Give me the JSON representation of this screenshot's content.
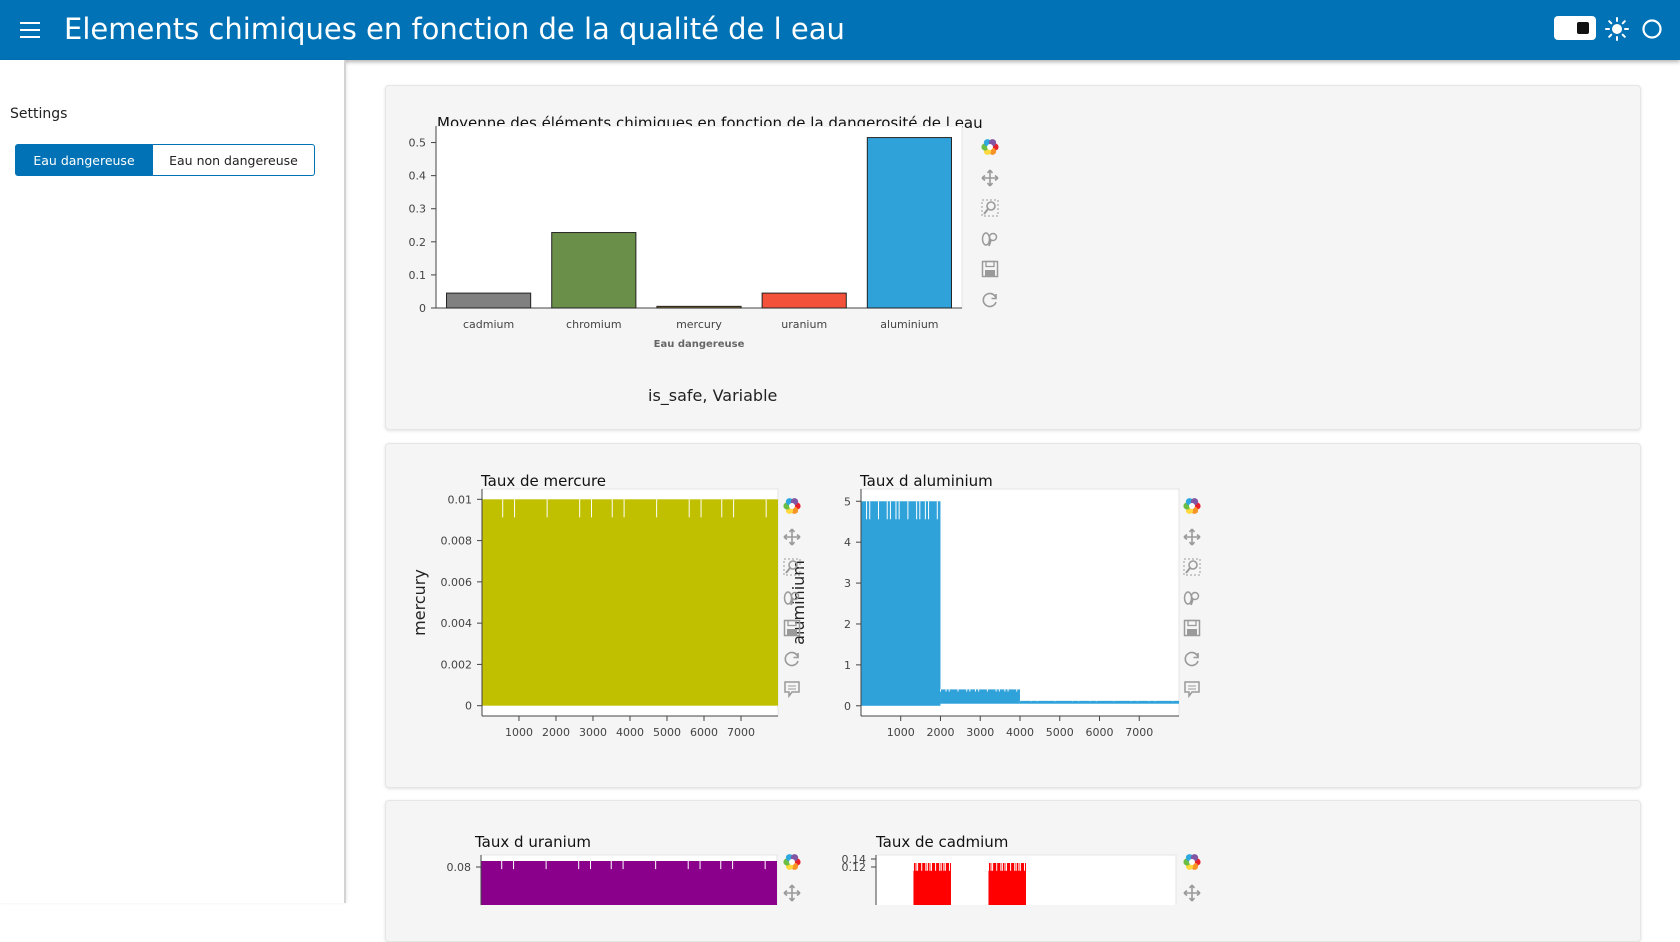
{
  "header": {
    "title": "Elements chimiques en fonction de la qualité de l eau",
    "background": "#0072b5"
  },
  "sidebar": {
    "title": "Settings",
    "buttons": [
      {
        "label": "Eau dangereuse",
        "active": true
      },
      {
        "label": "Eau non dangereuse",
        "active": false
      }
    ]
  },
  "main": {
    "bar_card": {
      "caption": "is_safe, Variable"
    }
  },
  "toolbar": {
    "icons": [
      "bokeh-logo-icon",
      "pan-icon",
      "box-zoom-icon",
      "wheel-zoom-icon",
      "save-icon",
      "reset-icon",
      "hover-icon"
    ]
  },
  "chart_data": [
    {
      "type": "bar",
      "title": "Moyenne des éléments chimiques en fonction de la dangerosité de l eau",
      "xlabel": "Eau dangereuse",
      "ylabel": "",
      "categories": [
        "cadmium",
        "chromium",
        "mercury",
        "uranium",
        "aluminium"
      ],
      "values": [
        0.045,
        0.228,
        0.005,
        0.045,
        0.515
      ],
      "colors": [
        "#808080",
        "#6a8f48",
        "#8b7433",
        "#f4513b",
        "#30a2da"
      ],
      "ylim": [
        0,
        0.55
      ],
      "yticks": [
        0,
        0.1,
        0.2,
        0.3,
        0.4,
        0.5
      ],
      "ytick_labels": [
        "0",
        "0.1",
        "0.2",
        "0.3",
        "0.4",
        "0.5"
      ]
    },
    {
      "type": "line",
      "title": "Taux de mercure",
      "xlabel": "",
      "ylabel": "mercury",
      "color": "#c0bf00",
      "xlim": [
        1,
        8000
      ],
      "ylim": [
        -0.0005,
        0.0105
      ],
      "xticks": [
        1000,
        2000,
        3000,
        4000,
        5000,
        6000,
        7000
      ],
      "xtick_labels": [
        "1000",
        "2000",
        "3000",
        "4000",
        "5000",
        "6000",
        "7000"
      ],
      "yticks": [
        0,
        0.002,
        0.004,
        0.006,
        0.008,
        0.01
      ],
      "ytick_labels": [
        "0",
        "0.002",
        "0.004",
        "0.006",
        "0.008",
        "0.01"
      ],
      "segments": [
        {
          "x0": 1,
          "x1": 8000,
          "lo": 0,
          "hi": 0.01
        }
      ]
    },
    {
      "type": "line",
      "title": "Taux d aluminium",
      "xlabel": "",
      "ylabel": "aluminium",
      "color": "#30a2da",
      "xlim": [
        1,
        8000
      ],
      "ylim": [
        -0.25,
        5.3
      ],
      "xticks": [
        1000,
        2000,
        3000,
        4000,
        5000,
        6000,
        7000
      ],
      "xtick_labels": [
        "1000",
        "2000",
        "3000",
        "4000",
        "5000",
        "6000",
        "7000"
      ],
      "yticks": [
        0,
        1,
        2,
        3,
        4,
        5
      ],
      "ytick_labels": [
        "0",
        "1",
        "2",
        "3",
        "4",
        "5"
      ],
      "segments": [
        {
          "x0": 1,
          "x1": 2000,
          "lo": 0,
          "hi": 5.0
        },
        {
          "x0": 2000,
          "x1": 4000,
          "lo": 0.05,
          "hi": 0.4
        },
        {
          "x0": 4000,
          "x1": 8000,
          "lo": 0.05,
          "hi": 0.12
        }
      ]
    },
    {
      "type": "line",
      "title": "Taux d uranium",
      "xlabel": "",
      "ylabel": "",
      "color": "#8b008b",
      "xlim": [
        1,
        8000
      ],
      "ylim": [
        0,
        0.1
      ],
      "yticks": [
        0.08
      ],
      "ytick_labels": [
        "0.08"
      ],
      "segments": [
        {
          "x0": 1,
          "x1": 8000,
          "lo": 0,
          "hi": 0.09
        }
      ]
    },
    {
      "type": "line",
      "title": "Taux de cadmium",
      "xlabel": "",
      "ylabel": "",
      "color": "#ff0000",
      "xlim": [
        1,
        8000
      ],
      "ylim": [
        0,
        0.15
      ],
      "yticks": [
        0.12,
        0.14
      ],
      "ytick_labels": [
        "0.12",
        "0.14"
      ],
      "segments": [
        {
          "x0": 1000,
          "x1": 2000,
          "lo": 0,
          "hi": 0.13
        },
        {
          "x0": 3000,
          "x1": 4000,
          "lo": 0,
          "hi": 0.13
        }
      ]
    }
  ]
}
